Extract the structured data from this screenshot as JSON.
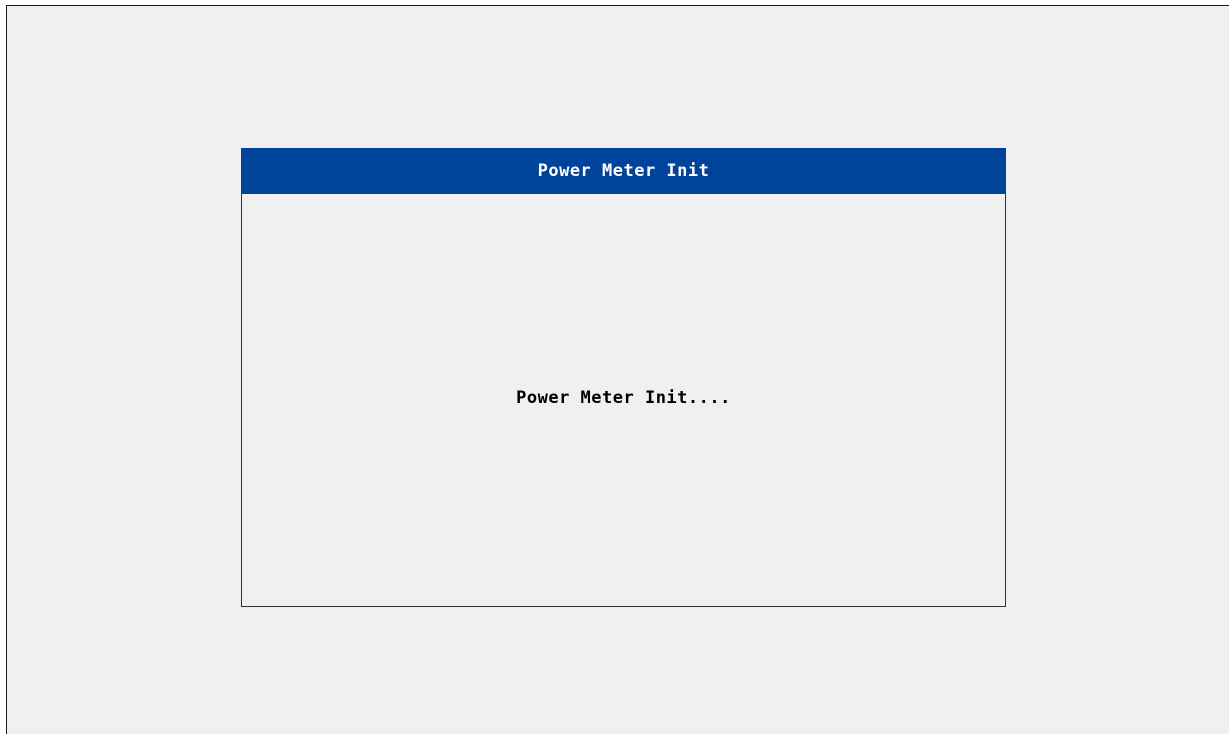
{
  "dialog": {
    "title": "Power Meter Init",
    "message": "Power Meter Init...."
  },
  "colors": {
    "title_bar": "#00439a",
    "background": "#f0f0f0",
    "border": "#333333",
    "text": "#000000",
    "title_text": "#ffffff"
  }
}
